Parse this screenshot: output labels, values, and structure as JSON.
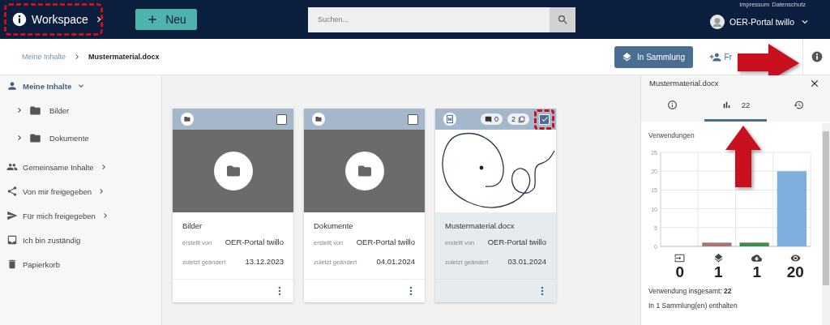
{
  "header": {
    "workspace": {
      "label": "Workspace",
      "highlighted": true
    },
    "new_button": "Neu",
    "search": {
      "placeholder": "Suchen..."
    },
    "legal_links": [
      "Impressum",
      "Datenschutz"
    ],
    "user": {
      "name": "OER-Portal twillo"
    }
  },
  "breadcrumb": [
    "Meine Inhalte",
    "Mustermaterial.docx"
  ],
  "actions": {
    "collection_button": "In Sammlung",
    "share_button": "Fr",
    "info_button": {
      "pointed": true
    }
  },
  "sidebar": {
    "items": [
      {
        "label": "Meine Inhalte",
        "selected": true,
        "expanded": true,
        "children": [
          {
            "label": "Bilder",
            "selected": false,
            "expanded": false
          },
          {
            "label": "Dokumente",
            "selected": false,
            "expanded": false
          }
        ]
      },
      {
        "label": "Gemeinsame Inhalte",
        "selected": false,
        "expanded": false
      },
      {
        "label": "Von mir freigegeben",
        "selected": false,
        "expanded": false
      },
      {
        "label": "Für mich freigegeben",
        "selected": false,
        "expanded": false
      },
      {
        "label": "Ich bin zuständig",
        "selected": false
      },
      {
        "label": "Papierkorb",
        "selected": false
      }
    ]
  },
  "cards": [
    {
      "kind": "folder",
      "title": "Bilder",
      "selected": false,
      "creator_label": "erstellt von",
      "creator": "OER-Portal twillo",
      "modified_label": "zuletzt geändert",
      "modified": "13.12.2023"
    },
    {
      "kind": "folder",
      "title": "Dokumente",
      "selected": false,
      "creator_label": "erstellt von",
      "creator": "OER-Portal twillo",
      "modified_label": "zuletzt geändert",
      "modified": "04.01.2024"
    },
    {
      "kind": "document",
      "title": "Mustermaterial.docx",
      "selected": true,
      "highlighted": true,
      "comments": "0",
      "collections": "2",
      "creator_label": "erstellt von",
      "creator": "OER-Portal twillo",
      "modified_label": "zuletzt geändert",
      "modified": "03.01.2024"
    }
  ],
  "details": {
    "title": "Mustermaterial.docx",
    "tabs": [
      {
        "kind": "info",
        "selected": false
      },
      {
        "kind": "usage",
        "label": "22",
        "selected": true,
        "pointed": true
      },
      {
        "kind": "history",
        "selected": false
      }
    ],
    "section_title": "Verwendungen",
    "chart_data": {
      "type": "bar",
      "grid": true,
      "values": [
        0,
        1,
        1,
        20
      ],
      "ylim": [
        0,
        25
      ],
      "yticks": [
        0,
        5,
        10,
        15,
        20,
        25
      ]
    },
    "usage_stats": [
      {
        "kind": "import",
        "count": "0"
      },
      {
        "kind": "collection",
        "count": "1",
        "color": "#a87476"
      },
      {
        "kind": "download",
        "count": "1",
        "color": "#3f8c4d"
      },
      {
        "kind": "view",
        "count": "20",
        "color": "#7eaede"
      }
    ],
    "total": "Verwendung insgesamt: **22**",
    "collections_note": "In 1 Sammlung(en) enthalten"
  }
}
